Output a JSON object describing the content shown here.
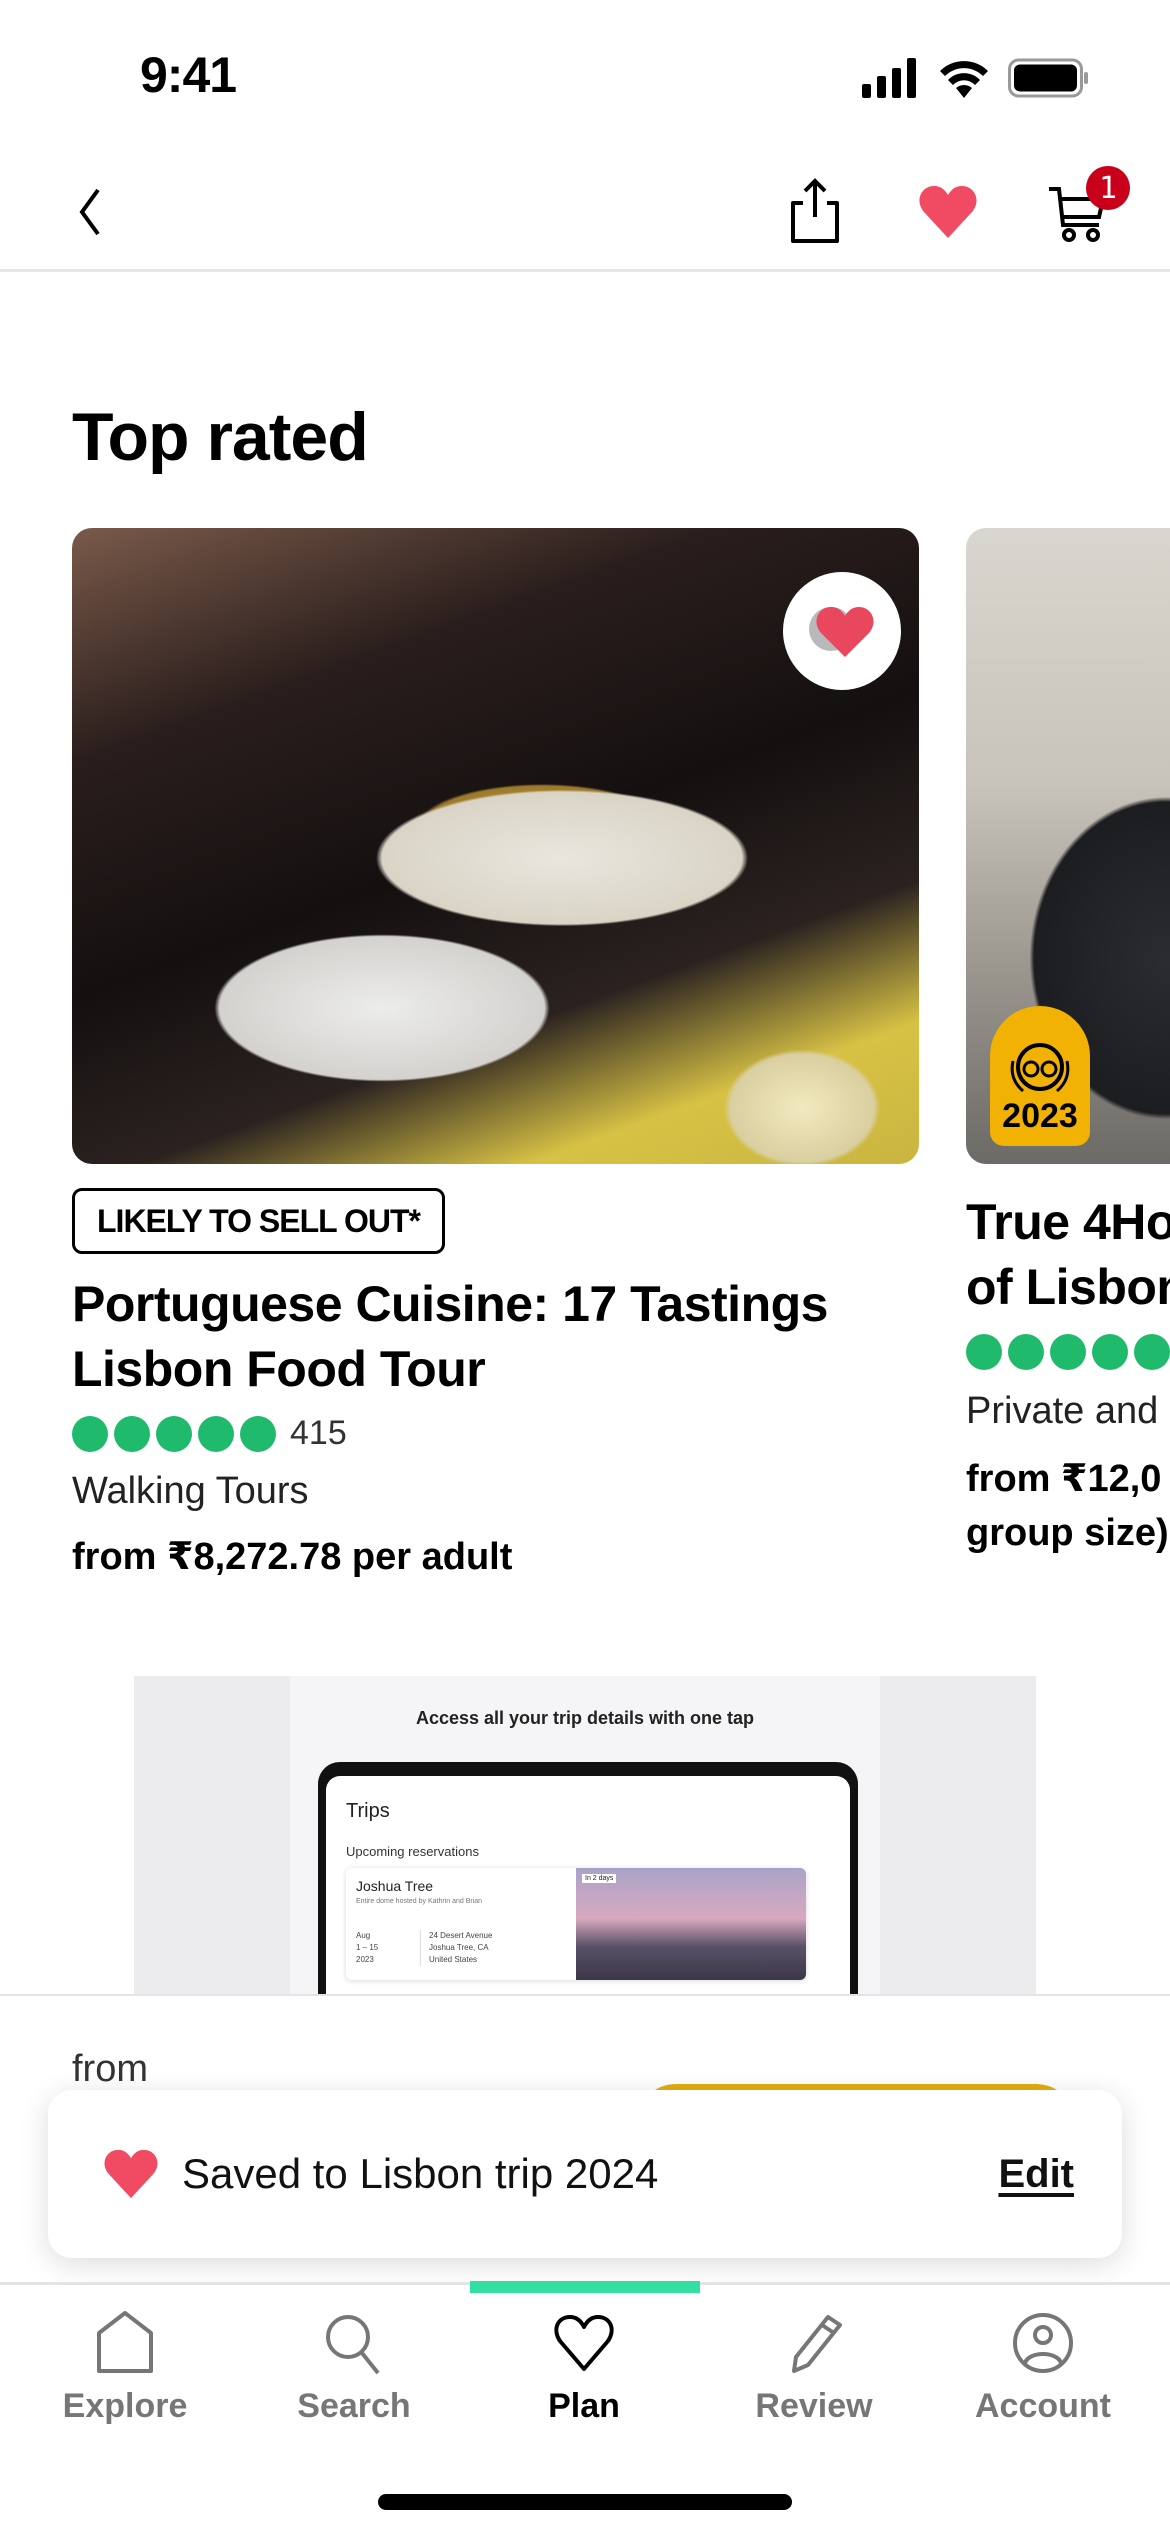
{
  "status_bar": {
    "time": "9:41"
  },
  "header": {
    "cart_count": "1"
  },
  "section": {
    "title": "Top rated"
  },
  "cards": [
    {
      "badge": "LIKELY TO SELL OUT*",
      "title": "Portuguese Cuisine: 17 Tastings Lisbon Food Tour",
      "rating_bubbles": 5,
      "review_count": "415",
      "category": "Walking Tours",
      "price": "from ₹8,272.78 per adult",
      "saved": true
    },
    {
      "title_line1": "True 4Ho",
      "title_line2": "of Lisbon",
      "rating_bubbles": 5,
      "category": "Private and",
      "price_line1": "from ₹12,0",
      "price_line2": "group size)",
      "award_year": "2023"
    }
  ],
  "promo": {
    "caption": "Access all your trip details with one tap",
    "trips_title": "Trips",
    "upcoming_label": "Upcoming reservations",
    "reservation": {
      "name": "Joshua Tree",
      "host": "Entire dome hosted by Kathrin and Brian",
      "date": "Aug\n1 – 15\n2023",
      "address": "24 Desert Avenue\nJoshua Tree, CA\nUnited States",
      "tag": "In 2 days"
    }
  },
  "booking_bar": {
    "from_label": "from"
  },
  "toast": {
    "message": "Saved to Lisbon trip 2024",
    "action": "Edit"
  },
  "tabs": [
    {
      "label": "Explore",
      "icon": "home-icon",
      "active": false
    },
    {
      "label": "Search",
      "icon": "search-icon",
      "active": false
    },
    {
      "label": "Plan",
      "icon": "heart-outline-icon",
      "active": true
    },
    {
      "label": "Review",
      "icon": "pencil-icon",
      "active": false
    },
    {
      "label": "Account",
      "icon": "account-icon",
      "active": false
    }
  ],
  "colors": {
    "accent_green": "#34e0a1",
    "bubble_green": "#1fba6b",
    "heart_red": "#f04b63",
    "badge_red": "#c8001a",
    "cta_yellow": "#e2ad12",
    "award_yellow": "#f2b203"
  }
}
